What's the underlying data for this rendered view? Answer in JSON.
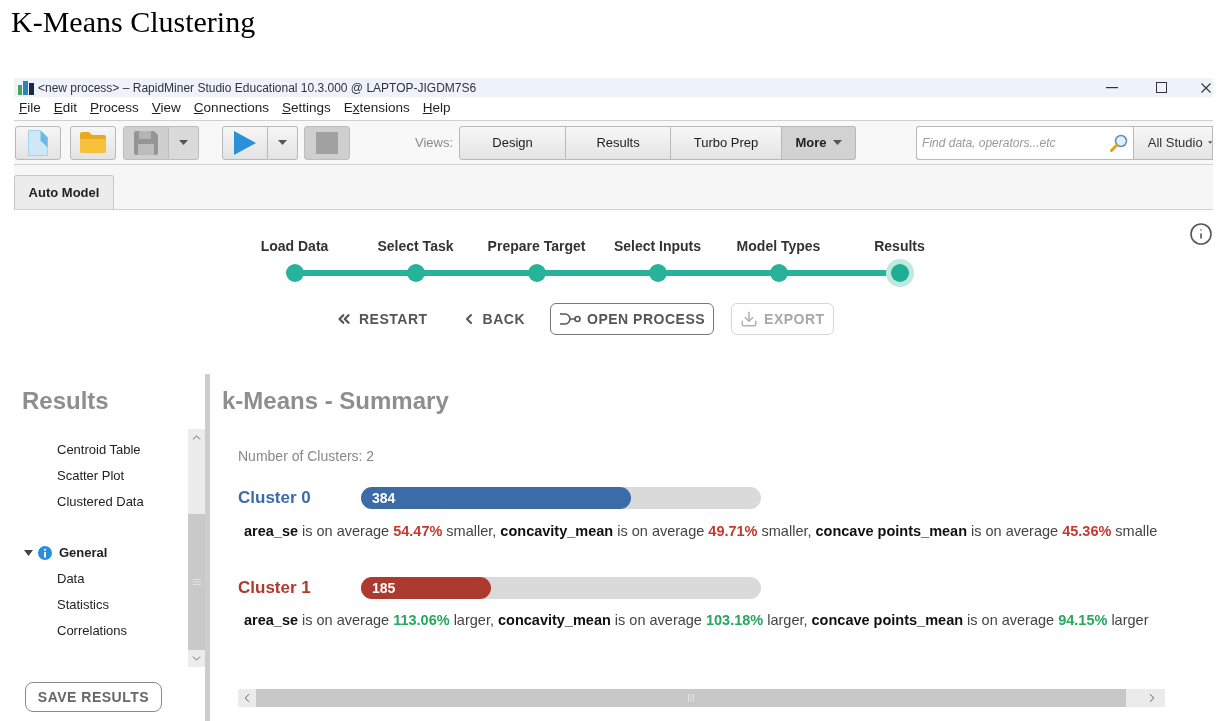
{
  "heading": "K-Means Clustering",
  "window": {
    "title": "<new process> – RapidMiner Studio Educational 10.3.000 @ LAPTOP-JIGDM7S6"
  },
  "menu": [
    {
      "key": "F",
      "after": "ile"
    },
    {
      "key": "E",
      "after": "dit"
    },
    {
      "key": "P",
      "after": "rocess"
    },
    {
      "key": "V",
      "after": "iew"
    },
    {
      "key": "C",
      "after": "onnections"
    },
    {
      "key": "S",
      "after": "ettings"
    },
    {
      "before": "E",
      "key": "x",
      "after": "tensions"
    },
    {
      "key": "H",
      "after": "elp"
    }
  ],
  "toolbar": {
    "buttons": [
      {
        "kind": "new",
        "disabled": false
      },
      {
        "kind": "open",
        "disabled": false
      },
      {
        "kind": "save",
        "disabled": true,
        "dropdown": true
      },
      {
        "kind": "run",
        "disabled": false,
        "dropdown": true
      },
      {
        "kind": "stop",
        "disabled": true
      }
    ],
    "views_label": "Views:",
    "views": [
      {
        "label": "Design",
        "selected": false
      },
      {
        "label": "Results",
        "selected": false
      },
      {
        "label": "Turbo Prep",
        "selected": false
      },
      {
        "label": "More",
        "selected": true,
        "dropdown": true
      }
    ],
    "search": {
      "placeholder": "Find data, operators...etc"
    },
    "scope": {
      "value": "All Studio"
    }
  },
  "tabs": [
    {
      "label": "Auto Model",
      "selected": true
    }
  ],
  "steps": [
    {
      "label": "Load Data",
      "selected": false
    },
    {
      "label": "Select Task",
      "selected": false
    },
    {
      "label": "Prepare Target",
      "selected": false
    },
    {
      "label": "Select Inputs",
      "selected": false
    },
    {
      "label": "Model Types",
      "selected": false
    },
    {
      "label": "Results",
      "selected": true
    }
  ],
  "actions": [
    {
      "kind": "restart",
      "label": "RESTART",
      "outlined": false,
      "disabled": false
    },
    {
      "kind": "back",
      "label": "BACK",
      "outlined": false,
      "disabled": false
    },
    {
      "kind": "open_process",
      "label": "OPEN PROCESS",
      "outlined": true,
      "disabled": false
    },
    {
      "kind": "export",
      "label": "EXPORT",
      "outlined": true,
      "disabled": true
    }
  ],
  "results_panel": {
    "title": "Results",
    "tree": [
      {
        "children": [
          {
            "label": "Centroid Table"
          },
          {
            "label": "Scatter Plot"
          },
          {
            "label": "Clustered Data"
          }
        ]
      },
      {
        "label": "General",
        "expanded": true,
        "children": [
          {
            "label": "Data"
          },
          {
            "label": "Statistics"
          },
          {
            "label": "Correlations"
          }
        ]
      }
    ],
    "save_button": "SAVE RESULTS"
  },
  "summary": {
    "title": "k-Means - Summary",
    "cluster_count": "Number of Clusters: 2",
    "clusters": [
      {
        "name": "Cluster 0",
        "color": "#3c6ca8",
        "count": "384",
        "level": 0.675,
        "kind": "decrease",
        "description": [
          {
            "kind": "feature",
            "text": "area_se"
          },
          {
            "kind": "text",
            "text": " is on average "
          },
          {
            "kind": "value",
            "text": "54.47%"
          },
          {
            "kind": "text",
            "text": " smaller, "
          },
          {
            "kind": "feature",
            "text": "concavity_mean"
          },
          {
            "kind": "text",
            "text": " is on average "
          },
          {
            "kind": "value",
            "text": "49.71%"
          },
          {
            "kind": "text",
            "text": " smaller, "
          },
          {
            "kind": "feature",
            "text": "concave points_mean"
          },
          {
            "kind": "text",
            "text": " is on average "
          },
          {
            "kind": "value",
            "text": "45.36%"
          },
          {
            "kind": "text",
            "text": " smalle"
          }
        ]
      },
      {
        "name": "Cluster 1",
        "color": "#ad3a2f",
        "count": "185",
        "level": 0.325,
        "kind": "increase",
        "description": [
          {
            "kind": "feature",
            "text": "area_se"
          },
          {
            "kind": "text",
            "text": " is on average "
          },
          {
            "kind": "value",
            "text": "113.06%"
          },
          {
            "kind": "text",
            "text": " larger, "
          },
          {
            "kind": "feature",
            "text": "concavity_mean"
          },
          {
            "kind": "text",
            "text": " is on average "
          },
          {
            "kind": "value",
            "text": "103.18%"
          },
          {
            "kind": "text",
            "text": " larger, "
          },
          {
            "kind": "feature",
            "text": "concave points_mean"
          },
          {
            "kind": "text",
            "text": " is on average "
          },
          {
            "kind": "value",
            "text": "94.15%"
          },
          {
            "kind": "text",
            "text": " larger"
          }
        ]
      }
    ]
  }
}
